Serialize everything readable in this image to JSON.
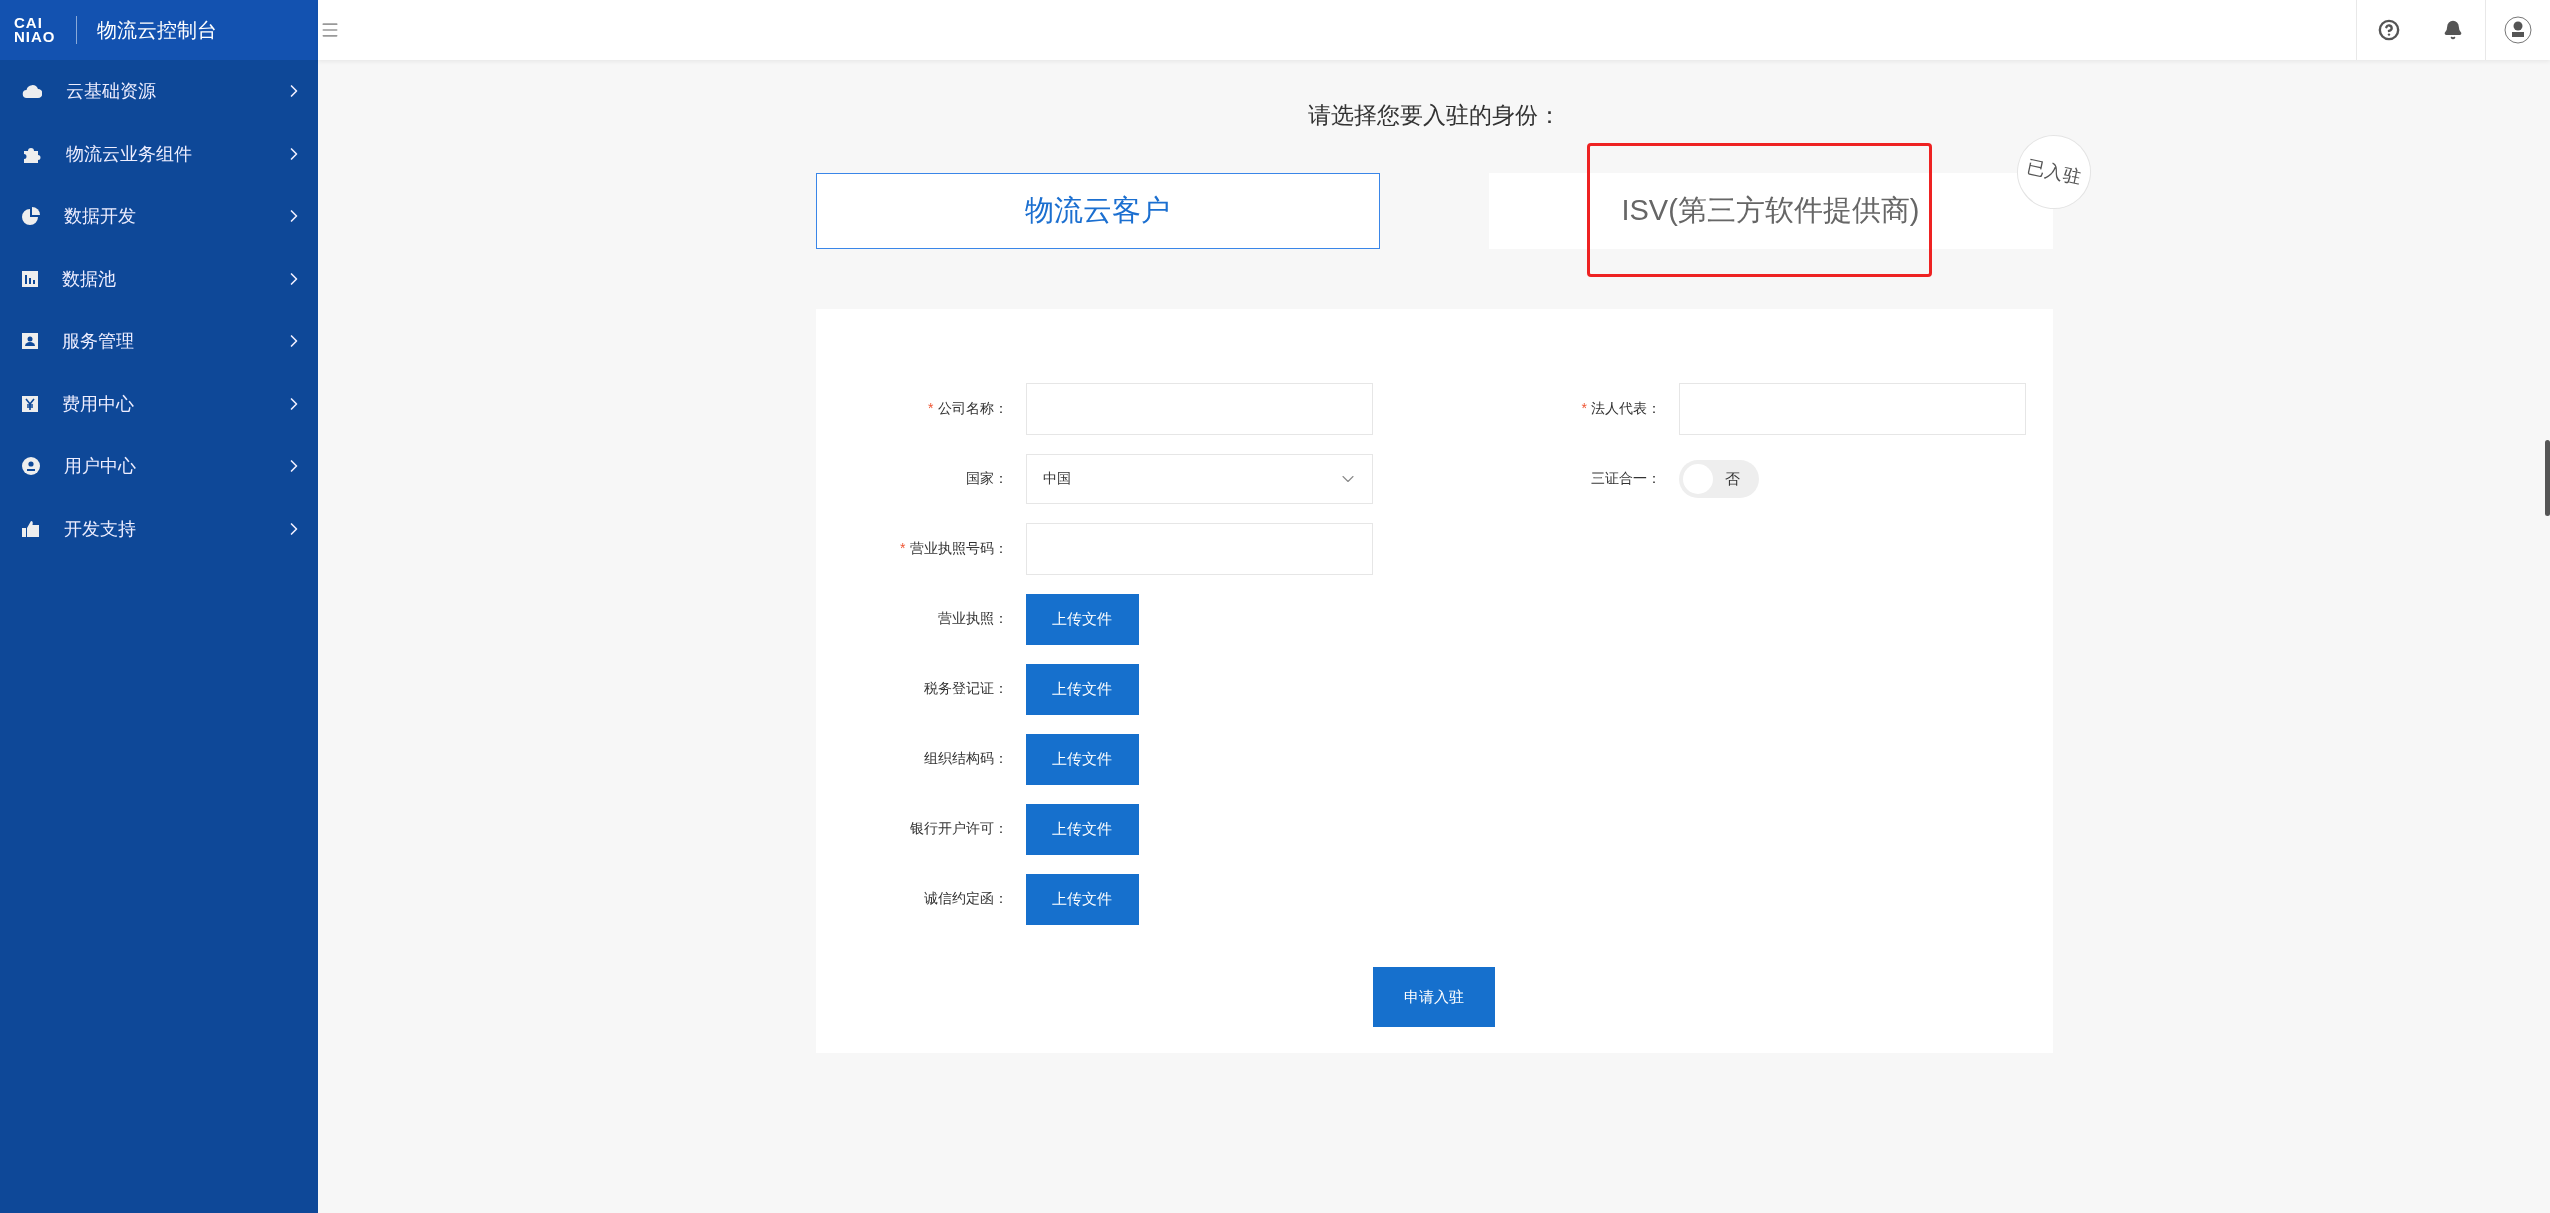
{
  "brand": {
    "logo_lines": [
      "CAI",
      "NIAO"
    ],
    "title": "物流云控制台"
  },
  "sidebar": {
    "items": [
      {
        "label": "云基础资源",
        "expanded": false
      },
      {
        "label": "物流云业务组件",
        "expanded": false
      },
      {
        "label": "数据开发",
        "expanded": false
      },
      {
        "label": "数据池",
        "expanded": false
      },
      {
        "label": "服务管理",
        "expanded": false
      },
      {
        "label": "费用中心",
        "expanded": false
      },
      {
        "label": "用户中心",
        "expanded": false
      },
      {
        "label": "开发支持",
        "expanded": false
      }
    ]
  },
  "identity": {
    "prompt": "请选择您要入驻的身份：",
    "options": [
      {
        "label": "物流云客户",
        "selected": true,
        "highlighted": false
      },
      {
        "label": "ISV(第三方软件提供商)",
        "selected": false,
        "highlighted": true,
        "badge": "已入驻"
      }
    ]
  },
  "form": {
    "required_mark": "*",
    "fields": [
      {
        "kind": "input",
        "label": "公司名称：",
        "required": true
      },
      {
        "kind": "input",
        "label": "法人代表：",
        "required": true
      },
      {
        "kind": "select",
        "label": "国家：",
        "required": false,
        "value": "中国"
      },
      {
        "kind": "switch",
        "label": "三证合一：",
        "required": false,
        "on": false,
        "text": "否"
      },
      {
        "kind": "input",
        "label": "营业执照号码：",
        "required": true
      },
      {
        "kind": "upload",
        "label": "营业执照：",
        "required": false,
        "button": "上传文件"
      },
      {
        "kind": "upload",
        "label": "税务登记证：",
        "required": false,
        "button": "上传文件"
      },
      {
        "kind": "upload",
        "label": "组织结构码：",
        "required": false,
        "button": "上传文件"
      },
      {
        "kind": "upload",
        "label": "银行开户许可：",
        "required": false,
        "button": "上传文件"
      },
      {
        "kind": "upload",
        "label": "诚信约定函：",
        "required": false,
        "button": "上传文件"
      }
    ],
    "submit": "申请入驻"
  }
}
